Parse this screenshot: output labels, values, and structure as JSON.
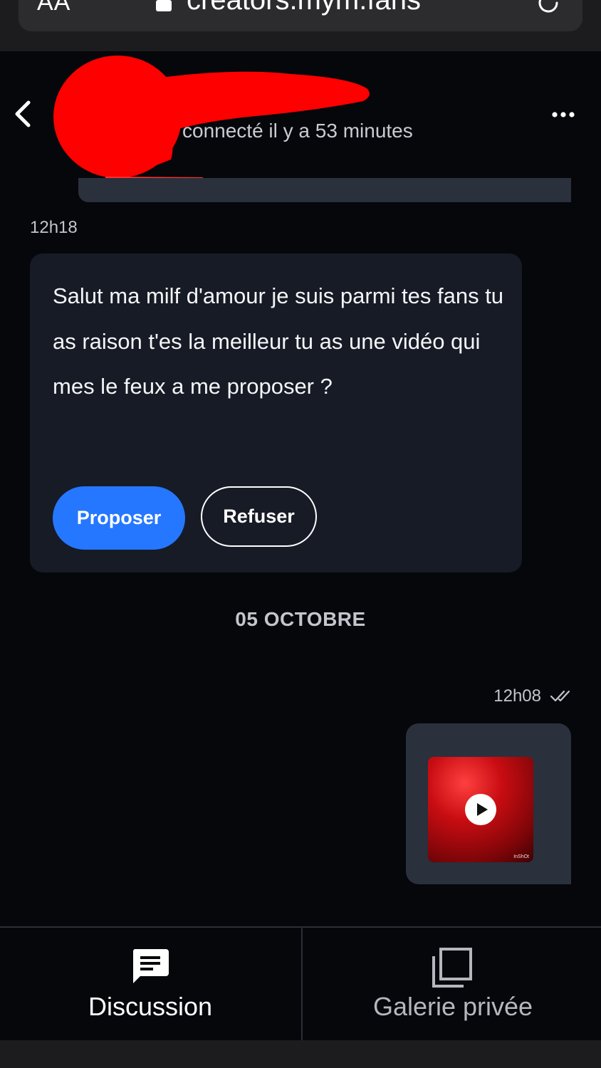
{
  "browser": {
    "aa_label": "AA",
    "url": "creators.mym.fans"
  },
  "header": {
    "status": "connecté il y a 53 minutes"
  },
  "messages": {
    "incoming_time": "12h18",
    "incoming_text": "Salut ma milf d'amour je suis parmi tes fans tu as raison t'es la meilleur tu as une vidéo qui mes le feux a me proposer ?",
    "propose_label": "Proposer",
    "refuse_label": "Refuser",
    "date_separator": "05 OCTOBRE",
    "outgoing_time": "12h08",
    "video_watermark": "InShOt"
  },
  "tabs": [
    {
      "label": "Discussion",
      "icon": "chat-icon",
      "active": true
    },
    {
      "label": "Galerie privée",
      "icon": "gallery-icon",
      "active": false
    }
  ],
  "colors": {
    "background": "#05070b",
    "bubble_incoming": "#161b26",
    "bubble_outgoing": "#2a303c",
    "accent": "#2577ff",
    "redaction": "#ff0000"
  }
}
